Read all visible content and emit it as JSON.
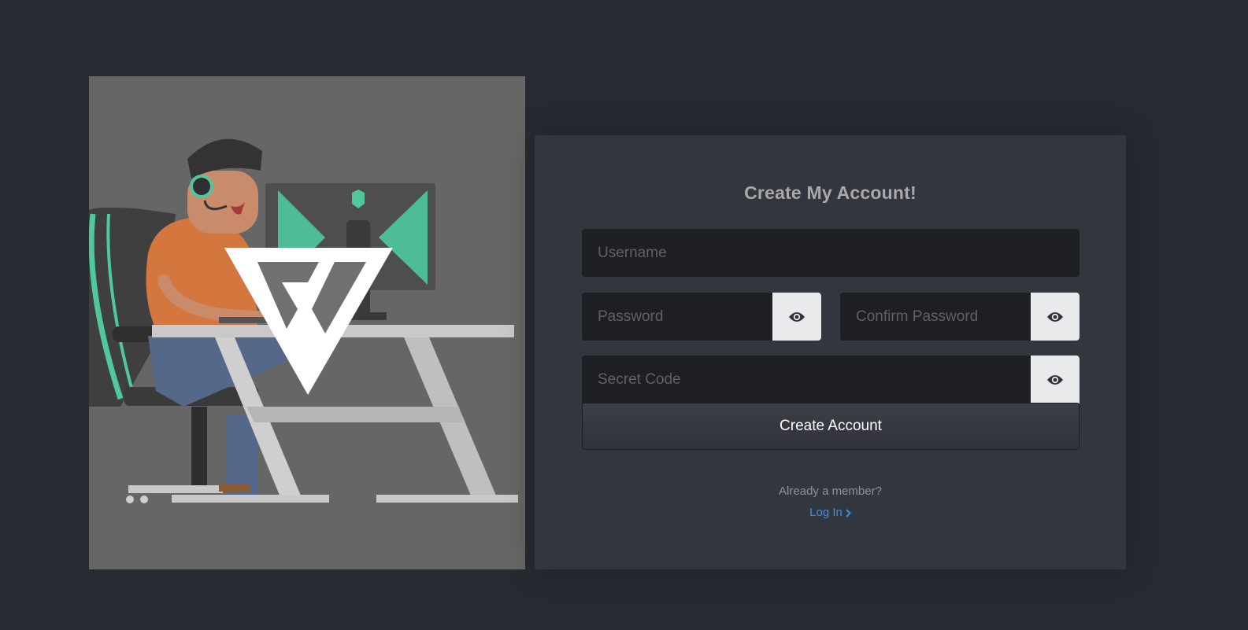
{
  "hero": {
    "image": "gamer-at-desk-illustration",
    "logo_icon": "triangle-logo-icon"
  },
  "form": {
    "title": "Create My Account!",
    "username": {
      "placeholder": "Username",
      "value": ""
    },
    "password": {
      "placeholder": "Password",
      "value": "",
      "toggle_icon": "eye-icon"
    },
    "confirm_password": {
      "placeholder": "Confirm Password",
      "value": "",
      "toggle_icon": "eye-icon"
    },
    "secret_code": {
      "placeholder": "Secret Code",
      "value": "",
      "toggle_icon": "eye-icon"
    },
    "submit_label": "Create Account",
    "member_text": "Already a member?",
    "login_label": "Log In",
    "login_icon": "chevron-right-icon"
  },
  "colors": {
    "background": "#272a30",
    "card": "#32363e",
    "input": "#1e1f23",
    "link": "#3c8ee8",
    "accent_green": "#4fc99c",
    "shirt_orange": "#d4773e"
  }
}
